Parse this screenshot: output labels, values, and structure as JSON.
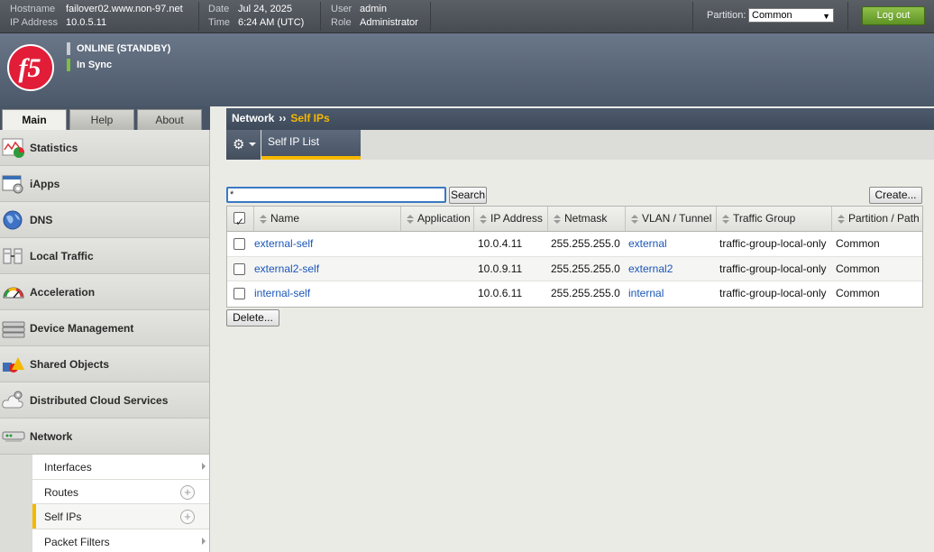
{
  "topbar": {
    "hostname_key": "Hostname",
    "hostname": "failover02.www.non-97.net",
    "ip_key": "IP Address",
    "ip": "10.0.5.11",
    "date_key": "Date",
    "date": "Jul 24, 2025",
    "time_key": "Time",
    "time": "6:24 AM (UTC)",
    "user_key": "User",
    "user": "admin",
    "role_key": "Role",
    "role": "Administrator",
    "partition_label": "Partition:",
    "partition_value": "Common",
    "logout_label": "Log out"
  },
  "banner": {
    "status": "ONLINE (STANDBY)",
    "sync": "In Sync"
  },
  "nav": {
    "tabs": [
      "Main",
      "Help",
      "About"
    ],
    "items": [
      {
        "label": "Statistics",
        "icon": "statistics-icon"
      },
      {
        "label": "iApps",
        "icon": "iapps-icon"
      },
      {
        "label": "DNS",
        "icon": "dns-globe-icon"
      },
      {
        "label": "Local Traffic",
        "icon": "local-traffic-icon"
      },
      {
        "label": "Acceleration",
        "icon": "acceleration-gauge-icon"
      },
      {
        "label": "Device Management",
        "icon": "device-management-icon"
      },
      {
        "label": "Shared Objects",
        "icon": "shared-objects-icon"
      },
      {
        "label": "Distributed Cloud Services",
        "icon": "cloud-services-icon"
      },
      {
        "label": "Network",
        "icon": "network-icon"
      }
    ],
    "sub_items": [
      {
        "label": "Interfaces"
      },
      {
        "label": "Routes"
      },
      {
        "label": "Self IPs"
      },
      {
        "label": "Packet Filters"
      }
    ]
  },
  "breadcrumb": {
    "section": "Network",
    "separator": "››",
    "current": "Self IPs"
  },
  "subtab": {
    "label": "Self IP List"
  },
  "search": {
    "value": "*",
    "button": "Search"
  },
  "buttons": {
    "create": "Create...",
    "delete": "Delete..."
  },
  "table": {
    "headers": [
      "Name",
      "Application",
      "IP Address",
      "Netmask",
      "VLAN / Tunnel",
      "Traffic Group",
      "Partition / Path"
    ],
    "rows": [
      {
        "name": "external-self",
        "application": "",
        "ip": "10.0.4.11",
        "netmask": "255.255.255.0",
        "vlan": "external",
        "traffic_group": "traffic-group-local-only",
        "partition": "Common"
      },
      {
        "name": "external2-self",
        "application": "",
        "ip": "10.0.9.11",
        "netmask": "255.255.255.0",
        "vlan": "external2",
        "traffic_group": "traffic-group-local-only",
        "partition": "Common"
      },
      {
        "name": "internal-self",
        "application": "",
        "ip": "10.0.6.11",
        "netmask": "255.255.255.0",
        "vlan": "internal",
        "traffic_group": "traffic-group-local-only",
        "partition": "Common"
      }
    ]
  },
  "colors": {
    "accent": "#f5b800",
    "link": "#1a56b8",
    "logout": "#6fa52f",
    "sync": "#7cc043",
    "logo": "#e21d38"
  }
}
